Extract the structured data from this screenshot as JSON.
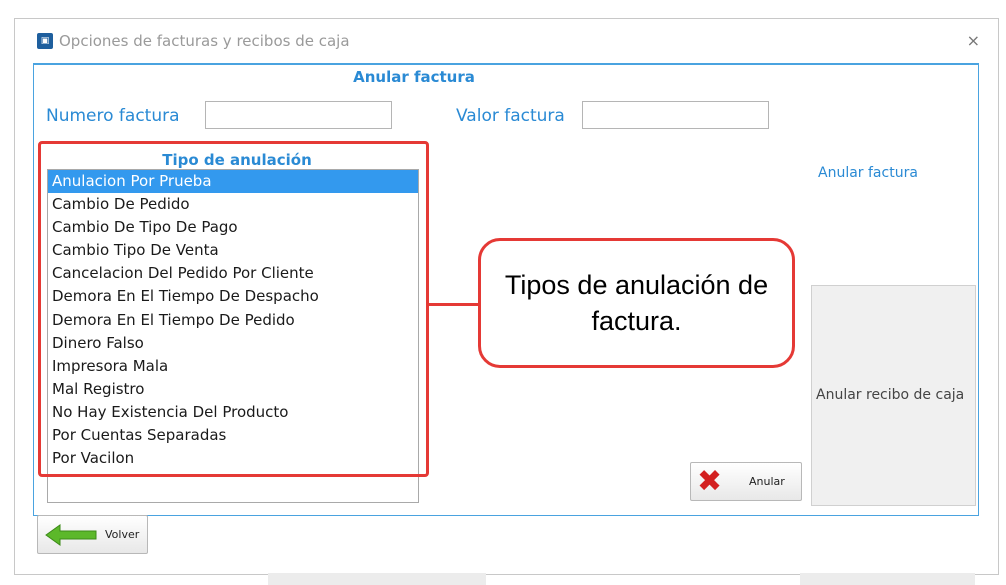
{
  "window": {
    "title": "Opciones de facturas y recibos de caja",
    "close_glyph": "×",
    "app_icon": "app-logo-icon"
  },
  "panel": {
    "title": "Anular factura",
    "numero_label": "Numero factura",
    "numero_value": "",
    "valor_label": "Valor factura",
    "valor_value": "",
    "tipo_title": "Tipo de anulación",
    "tipos": [
      "Anulacion Por Prueba",
      "Cambio De Pedido",
      "Cambio De Tipo De Pago",
      "Cambio Tipo De Venta",
      "Cancelacion Del Pedido Por Cliente",
      "Demora En El Tiempo De Despacho",
      "Demora En El Tiempo De Pedido",
      "Dinero Falso",
      "Impresora Mala",
      "Mal Registro",
      "No Hay Existencia Del Producto",
      "Por Cuentas Separadas",
      "Por Vacilon"
    ],
    "selected_tipo": "Anulacion Por Prueba",
    "anular_button": "Anular",
    "anular_icon": "red-x-icon"
  },
  "side": {
    "anular_factura": "Anular factura",
    "anular_recibo": "Anular recibo de caja"
  },
  "callout": {
    "text": "Tipos de anulación de factura."
  },
  "footer": {
    "volver_button": "Volver",
    "volver_icon": "green-arrow-left-icon"
  },
  "colors": {
    "accent": "#2a8ad4",
    "selection": "#3399ee",
    "annotation": "#e53935"
  }
}
